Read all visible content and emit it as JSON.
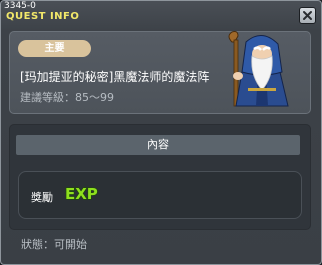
{
  "window": {
    "quest_id": "3345-0",
    "title": "QUEST INFO"
  },
  "summary": {
    "badge": "主要",
    "quest_name": "[玛加提亚的秘密]黑魔法师的魔法阵",
    "level_requirement": "建議等級：85～99",
    "npc_icon": "wizard-npc-icon"
  },
  "content": {
    "header": "內容",
    "reward_label": "獎勵",
    "reward_icon": "exp-icon",
    "reward_icon_text": "EXP"
  },
  "footer": {
    "status": "狀態：可開始"
  },
  "colors": {
    "title": "#f2e86a",
    "badge": "#d9c39c",
    "exp_green": "#8fe01e"
  }
}
